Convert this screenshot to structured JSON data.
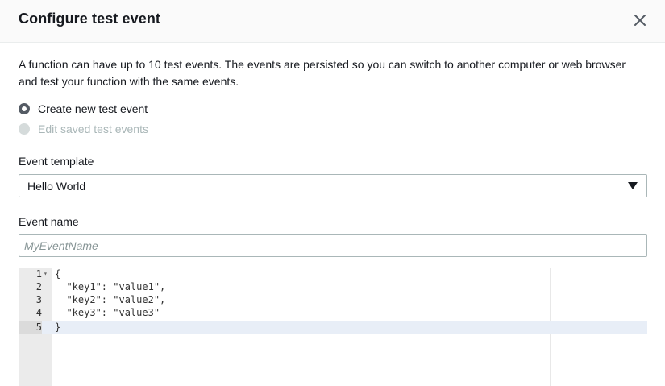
{
  "dialog": {
    "title": "Configure test event",
    "close_icon": "close-icon"
  },
  "description": "A function can have up to 10 test events. The events are persisted so you can switch to another computer or web browser and test your function with the same events.",
  "options": {
    "create_new": "Create new test event",
    "edit_saved": "Edit saved test events",
    "selected": "create_new"
  },
  "event_template": {
    "label": "Event template",
    "value": "Hello World"
  },
  "event_name": {
    "label": "Event name",
    "placeholder": "MyEventName",
    "value": ""
  },
  "editor": {
    "lines": [
      {
        "number": "1",
        "code": "{"
      },
      {
        "number": "2",
        "code": "  \"key1\": \"value1\","
      },
      {
        "number": "3",
        "code": "  \"key2\": \"value2\","
      },
      {
        "number": "4",
        "code": "  \"key3\": \"value3\""
      },
      {
        "number": "5",
        "code": "}"
      }
    ],
    "active_line": 5
  }
}
